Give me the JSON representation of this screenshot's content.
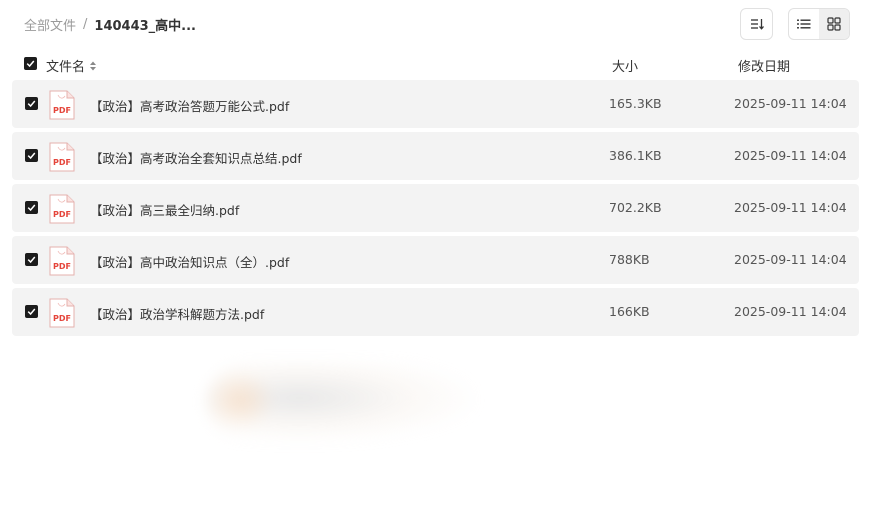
{
  "breadcrumb": {
    "root": "全部文件",
    "separator": "/",
    "current": "140443_高中..."
  },
  "toolbar": {
    "sort_icon": "sort-descending-icon",
    "list_view_icon": "list-view-icon",
    "grid_view_icon": "grid-view-icon",
    "active_view": "grid"
  },
  "columns": {
    "name": "文件名",
    "size": "大小",
    "date": "修改日期"
  },
  "files": [
    {
      "name": "【政治】高考政治答题万能公式.pdf",
      "size": "165.3KB",
      "date": "2025-09-11 14:04",
      "type": "PDF",
      "checked": true
    },
    {
      "name": "【政治】高考政治全套知识点总结.pdf",
      "size": "386.1KB",
      "date": "2025-09-11 14:04",
      "type": "PDF",
      "checked": true
    },
    {
      "name": "【政治】高三最全归纳.pdf",
      "size": "702.2KB",
      "date": "2025-09-11 14:04",
      "type": "PDF",
      "checked": true
    },
    {
      "name": "【政治】高中政治知识点（全）.pdf",
      "size": "788KB",
      "date": "2025-09-11 14:04",
      "type": "PDF",
      "checked": true
    },
    {
      "name": "【政治】政治学科解题方法.pdf",
      "size": "166KB",
      "date": "2025-09-11 14:04",
      "type": "PDF",
      "checked": true
    }
  ],
  "colors": {
    "row_bg": "#f3f3f3",
    "checkbox": "#1c1c1c",
    "pdf_red": "#e5453b"
  }
}
